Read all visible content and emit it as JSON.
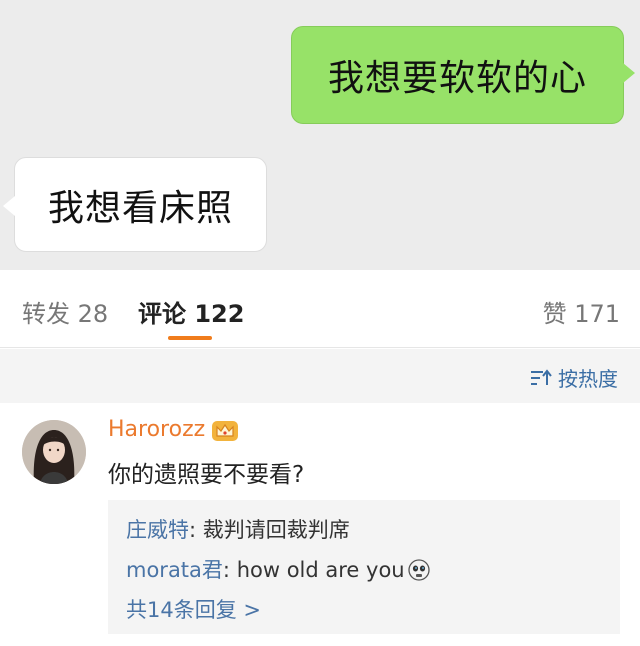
{
  "chat": {
    "message_right": "我想要软软的心",
    "message_left": "我想看床照"
  },
  "tabs": {
    "repost": "转发 28",
    "comments": "评论 122",
    "likes": "赞 171"
  },
  "sort": {
    "label": "按热度",
    "icon": "sort-icon"
  },
  "comment": {
    "username": "Harorozz",
    "badge_icon": "crown-badge-icon",
    "text": "你的遗照要不要看?",
    "replies": [
      {
        "name": "庄威特",
        "separator": ": ",
        "text": "裁判请回裁判席"
      },
      {
        "name": "morata君",
        "separator": ": ",
        "text": "how old are you",
        "emoji": "skull-emoji-icon"
      }
    ],
    "more_replies": "共14条回复 >"
  },
  "colors": {
    "chat_bg": "#ececec",
    "bubble_green": "#97e268",
    "accent_orange": "#f07c1c",
    "username_orange": "#eb7a2e",
    "link_blue": "#4a74a6"
  }
}
